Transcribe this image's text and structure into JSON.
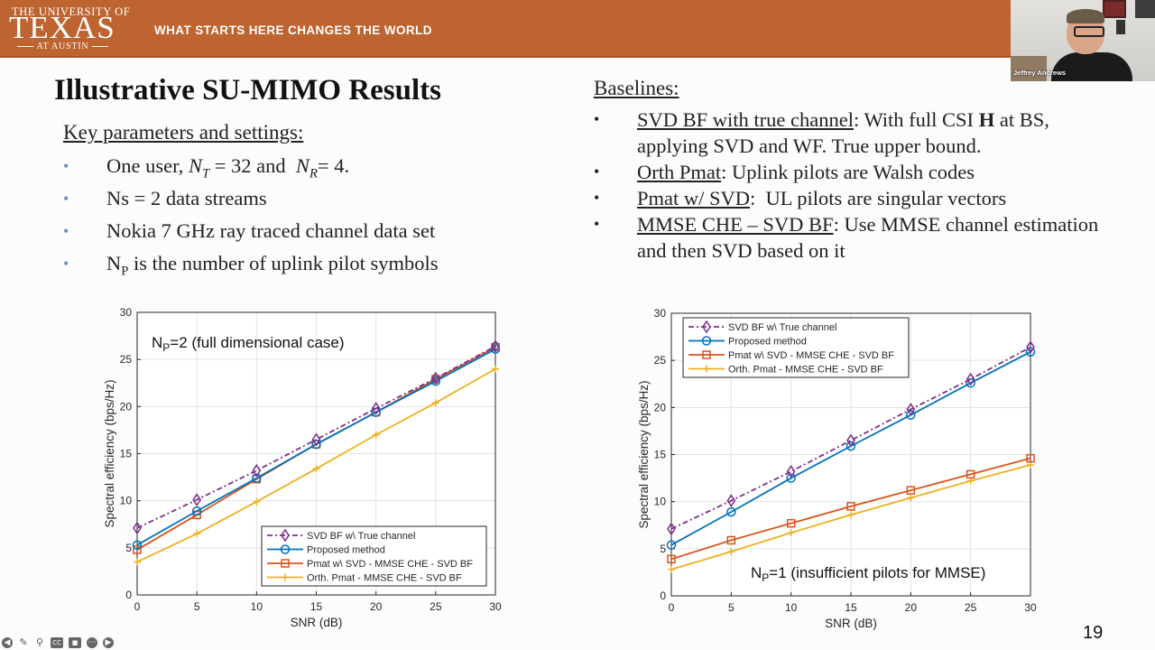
{
  "header": {
    "university_small": "THE UNIVERSITY OF",
    "university_big": "TEXAS",
    "university_campus": "AT AUSTIN",
    "tagline": "WHAT STARTS HERE CHANGES THE WORLD",
    "brand_color": "#bd6430"
  },
  "video": {
    "participant_name": "Jeffrey Andrews"
  },
  "slide": {
    "title": "Illustrative SU-MIMO Results",
    "left_heading": "Key parameters and settings:",
    "left_bullets": [
      {
        "pre": "One user, ",
        "m1": "N",
        "s1": "T",
        "mid": " = 32 and  ",
        "m2": "N",
        "s2": "R",
        "post": "= 4."
      },
      {
        "text": "Ns = 2 data streams"
      },
      {
        "text": "Nokia 7 GHz ray traced channel data set"
      },
      {
        "pre": "N",
        "sub": "P",
        "post": " is the number of uplink pilot symbols"
      }
    ],
    "right_heading": "Baselines:",
    "right_bullets": [
      {
        "term": "SVD BF with true channel",
        "desc_a": ": With full CSI ",
        "bold": "H",
        "desc_b": " at BS, applying SVD and WF.  True upper bound."
      },
      {
        "term": "Orth Pmat",
        "desc_a": ": Uplink pilots are Walsh codes"
      },
      {
        "term": "Pmat w/ SVD",
        "desc_a": ":  UL pilots are singular vectors"
      },
      {
        "term": "MMSE CHE – SVD BF",
        "desc_a": ": Use MMSE channel estimation and then SVD based on it"
      }
    ],
    "page_number": "19"
  },
  "toolbar": {
    "icons": [
      "previous-slide-icon",
      "pen-icon",
      "zoom-icon",
      "captions-icon",
      "camera-icon",
      "more-icon",
      "next-slide-icon"
    ]
  },
  "chart_data": [
    {
      "type": "line",
      "annotation": "N_P=2 (full dimensional case)",
      "annotation_main": "N",
      "annotation_sub": "P",
      "annotation_rest": "=2 (full dimensional case)",
      "xlabel": "SNR (dB)",
      "ylabel": "Spectral efficiency (bps/Hz)",
      "x": [
        0,
        5,
        10,
        15,
        20,
        25,
        30
      ],
      "xlim": [
        0,
        30
      ],
      "ylim": [
        0,
        30
      ],
      "xticks": [
        0,
        5,
        10,
        15,
        20,
        25,
        30
      ],
      "yticks": [
        0,
        5,
        10,
        15,
        20,
        25,
        30
      ],
      "grid": true,
      "legend_position": "bottom-right",
      "series": [
        {
          "name": "SVD BF w\\ True channel",
          "color": "#7e2f8e",
          "marker": "diamond",
          "dash": "dashdot",
          "values": [
            7.1,
            10.1,
            13.2,
            16.5,
            19.8,
            23.0,
            26.4
          ]
        },
        {
          "name": "Proposed method",
          "color": "#0072bd",
          "marker": "circle",
          "dash": "solid",
          "values": [
            5.3,
            8.9,
            12.4,
            16.0,
            19.4,
            22.7,
            26.1
          ]
        },
        {
          "name": "Pmat w\\ SVD - MMSE CHE - SVD BF",
          "color": "#d95319",
          "marker": "square",
          "dash": "solid",
          "values": [
            4.8,
            8.5,
            12.3,
            16.0,
            19.4,
            22.9,
            26.3
          ]
        },
        {
          "name": "Orth. Pmat - MMSE CHE - SVD BF",
          "color": "#edb120",
          "marker": "plus",
          "dash": "solid",
          "values": [
            3.5,
            6.5,
            9.9,
            13.4,
            17.0,
            20.4,
            24.0
          ]
        }
      ]
    },
    {
      "type": "line",
      "annotation": "N_P=1 (insufficient pilots for MMSE)",
      "annotation_main": "N",
      "annotation_sub": "P",
      "annotation_rest": "=1 (insufficient pilots for MMSE)",
      "xlabel": "SNR (dB)",
      "ylabel": "Spectral efficiency (bps/Hz)",
      "x": [
        0,
        5,
        10,
        15,
        20,
        25,
        30
      ],
      "xlim": [
        0,
        30
      ],
      "ylim": [
        0,
        30
      ],
      "xticks": [
        0,
        5,
        10,
        15,
        20,
        25,
        30
      ],
      "yticks": [
        0,
        5,
        10,
        15,
        20,
        25,
        30
      ],
      "grid": true,
      "legend_position": "top-left",
      "series": [
        {
          "name": "SVD BF w\\ True channel",
          "color": "#7e2f8e",
          "marker": "diamond",
          "dash": "dashdot",
          "values": [
            7.1,
            10.1,
            13.2,
            16.5,
            19.8,
            23.0,
            26.4
          ]
        },
        {
          "name": "Proposed method",
          "color": "#0072bd",
          "marker": "circle",
          "dash": "solid",
          "values": [
            5.4,
            8.9,
            12.5,
            15.9,
            19.2,
            22.6,
            25.9
          ]
        },
        {
          "name": "Pmat w\\ SVD - MMSE CHE - SVD BF",
          "color": "#d95319",
          "marker": "square",
          "dash": "solid",
          "values": [
            3.9,
            5.9,
            7.7,
            9.5,
            11.2,
            12.9,
            14.6
          ]
        },
        {
          "name": "Orth. Pmat - MMSE CHE - SVD BF",
          "color": "#edb120",
          "marker": "plus",
          "dash": "solid",
          "values": [
            2.8,
            4.7,
            6.7,
            8.6,
            10.4,
            12.2,
            13.9
          ]
        }
      ]
    }
  ]
}
